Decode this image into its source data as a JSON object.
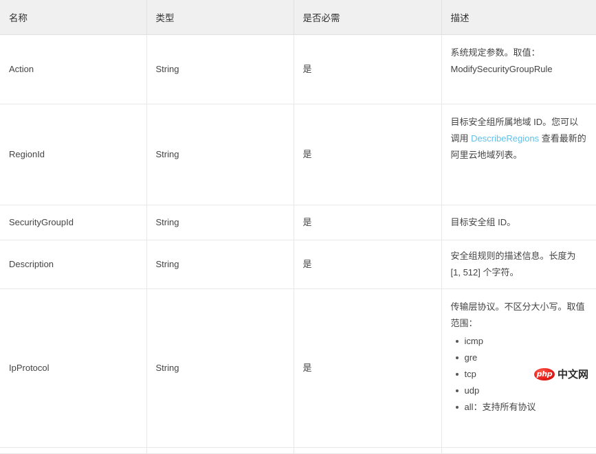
{
  "table": {
    "headers": [
      {
        "label": "名称"
      },
      {
        "label": "类型"
      },
      {
        "label": "是否必需"
      },
      {
        "label": "描述"
      }
    ],
    "rows": [
      {
        "name": "Action",
        "type": "String",
        "required": "是",
        "description": {
          "text": "系统规定参数。取值：ModifySecurityGroupRule",
          "line1": "系统规定参数。取值：",
          "line2": "ModifySecurityGroupRule"
        }
      },
      {
        "name": "RegionId",
        "type": "String",
        "required": "是",
        "description": {
          "before_link": "目标安全组所属地域 ID。您可以调用 ",
          "link_text": "DescribeRegions",
          "after_link": " 查看最新的阿里云地域列表。"
        }
      },
      {
        "name": "SecurityGroupId",
        "type": "String",
        "required": "是",
        "description": {
          "text": "目标安全组 ID。"
        }
      },
      {
        "name": "Description",
        "type": "String",
        "required": "是",
        "description": {
          "text": "安全组规则的描述信息。长度为 [1, 512] 个字符。"
        }
      },
      {
        "name": "IpProtocol",
        "type": "String",
        "required": "是",
        "description": {
          "text": "传输层协议。不区分大小写。取值范围：",
          "bullets": [
            "icmp",
            "gre",
            "tcp",
            "udp",
            "all：支持所有协议"
          ]
        }
      }
    ]
  },
  "watermark": {
    "badge_text": "php",
    "site_text": "中文网"
  },
  "colors": {
    "header_background": "#f0f0f0",
    "border": "#e8e8e8",
    "link": "#5fc0ea",
    "text": "#444444",
    "watermark_badge": "#e8201b"
  }
}
